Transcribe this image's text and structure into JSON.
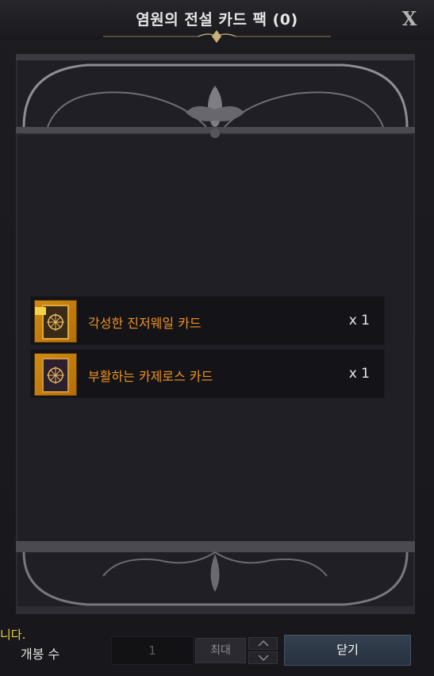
{
  "window": {
    "title": "염원의 전설 카드 팩 (0)",
    "close_glyph": "X"
  },
  "items": [
    {
      "name": "각성한 진저웨일 카드",
      "quantity": "x 1",
      "icon": "card-back-icon",
      "badge": "new-badge"
    },
    {
      "name": "부활하는 카제로스 카드",
      "quantity": "x 1",
      "icon": "card-back-icon"
    }
  ],
  "footer": {
    "side_text": "니다.",
    "open_count_label": "개봉 수",
    "count_value": "1",
    "max_label": "최대",
    "close_label": "닫기"
  },
  "colors": {
    "item_name": "#f0931f",
    "side_text": "#e8d23c",
    "close_button": "#2e3a48"
  }
}
